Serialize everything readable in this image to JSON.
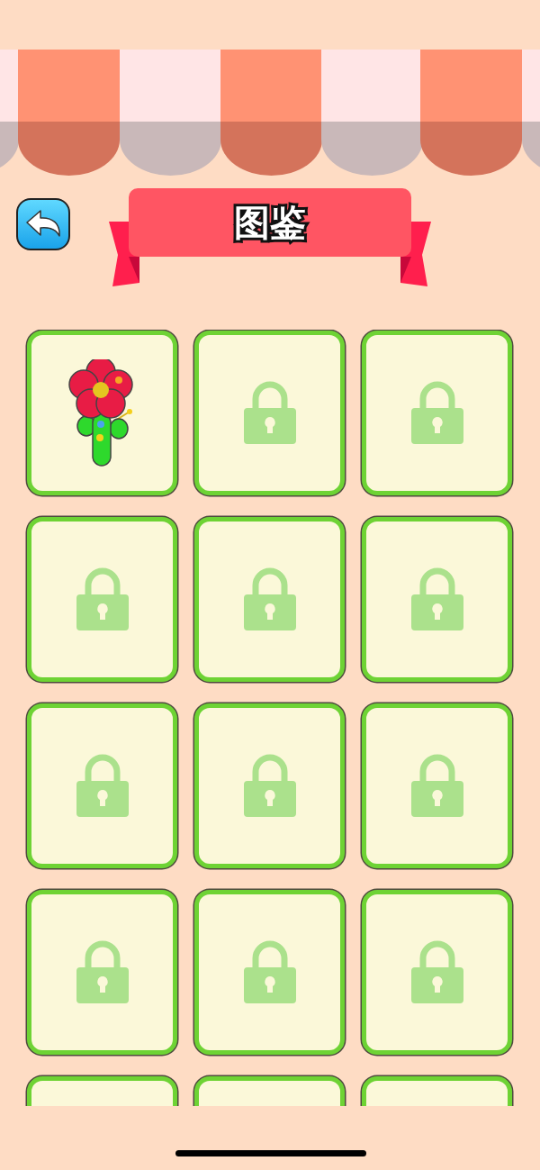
{
  "title": "图鉴",
  "cards": [
    {
      "kind": "flower"
    },
    {
      "kind": "locked"
    },
    {
      "kind": "locked"
    },
    {
      "kind": "locked"
    },
    {
      "kind": "locked"
    },
    {
      "kind": "locked"
    },
    {
      "kind": "locked"
    },
    {
      "kind": "locked"
    },
    {
      "kind": "locked"
    },
    {
      "kind": "locked"
    },
    {
      "kind": "locked"
    },
    {
      "kind": "locked"
    },
    {
      "kind": "blank"
    },
    {
      "kind": "blank"
    },
    {
      "kind": "blank"
    }
  ]
}
